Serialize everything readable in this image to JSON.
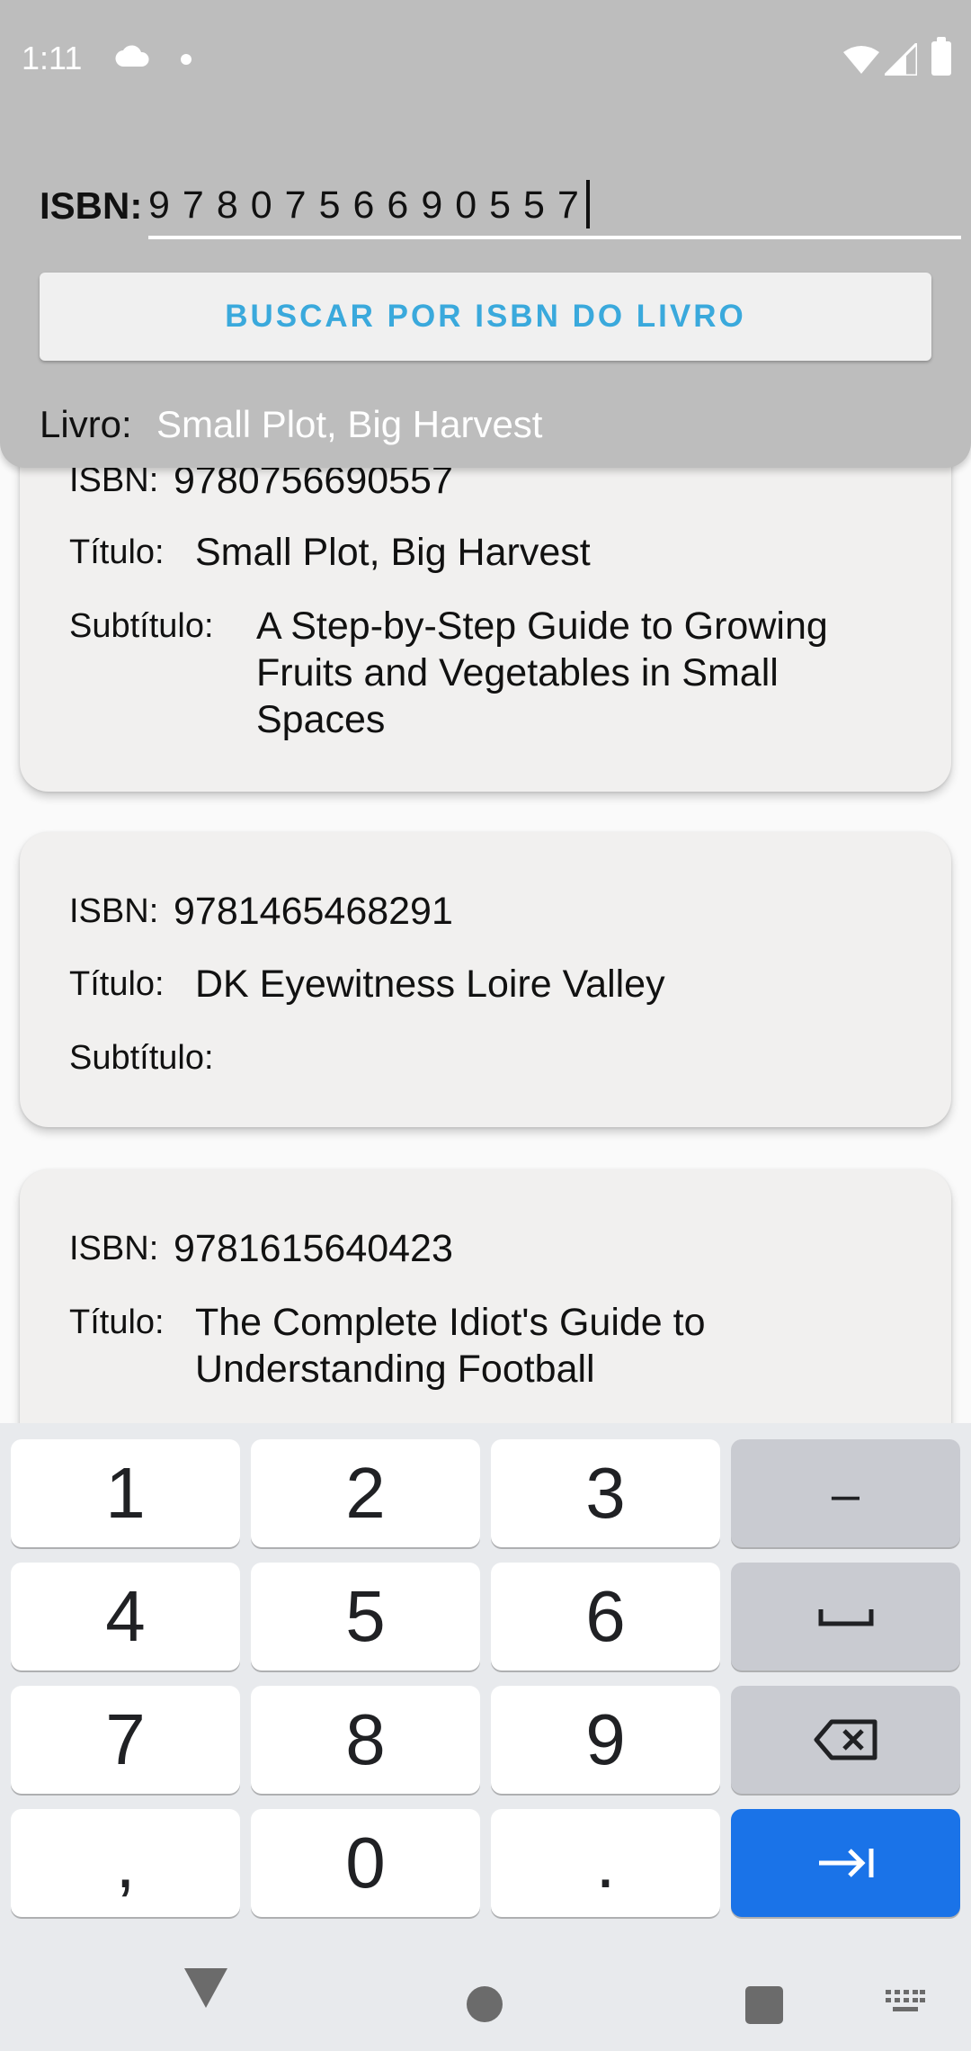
{
  "status_bar": {
    "time": "1:11"
  },
  "header": {
    "isbn_label": "ISBN:",
    "isbn_value": "9780756690557",
    "search_button": "BUSCAR POR ISBN DO LIVRO",
    "book_label": "Livro:",
    "book_value": "Small Plot, Big Harvest"
  },
  "labels": {
    "isbn": "ISBN:",
    "title": "Título:",
    "subtitle": "Subtítulo:"
  },
  "books": [
    {
      "isbn": "9780756690557",
      "title": "Small Plot, Big Harvest",
      "subtitle": "A Step-by-Step Guide to Growing Fruits and Vegetables in Small Spaces"
    },
    {
      "isbn": "9781465468291",
      "title": "DK Eyewitness Loire Valley",
      "subtitle": ""
    },
    {
      "isbn": "9781615640423",
      "title": "The Complete Idiot's Guide to Understanding Football",
      "subtitle": ""
    }
  ],
  "keyboard": {
    "keys": [
      "1",
      "2",
      "3",
      "–",
      "4",
      "5",
      "6",
      "space",
      "7",
      "8",
      "9",
      "backspace",
      ",",
      "0",
      ".",
      "enter"
    ]
  },
  "colors": {
    "header_bg": "#bdbdbd",
    "button_text": "#3aa9dc",
    "enter_key": "#1a73e8"
  },
  "icons": [
    "cloud-icon",
    "wifi-icon",
    "signal-icon",
    "battery-icon",
    "space-icon",
    "backspace-icon",
    "tab-arrow-icon",
    "nav-back-icon",
    "nav-home-icon",
    "nav-recent-icon",
    "keyboard-icon"
  ]
}
